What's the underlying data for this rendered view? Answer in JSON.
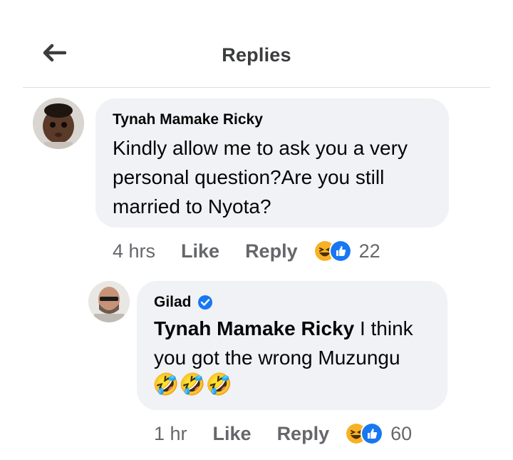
{
  "header": {
    "title": "Replies"
  },
  "comment": {
    "author": "Tynah Mamake Ricky",
    "text": "Kindly allow me to ask you a very personal question?Are you still married to Nyota?",
    "time": "4 hrs",
    "like_label": "Like",
    "reply_label": "Reply",
    "reaction_count": "22",
    "reactions": [
      "haha-icon",
      "like-icon"
    ]
  },
  "reply": {
    "author": "Gilad",
    "verified": true,
    "mention": "Tynah Mamake Ricky",
    "text": " I think you got the wrong Muzungu",
    "emoji": "🤣🤣🤣",
    "time": "1 hr",
    "like_label": "Like",
    "reply_label": "Reply",
    "reaction_count": "60",
    "reactions": [
      "haha-icon",
      "like-icon"
    ]
  },
  "colors": {
    "bubble": "#f0f2f5",
    "meta_text": "#65676b",
    "like_blue": "#1877f2",
    "haha_yellow": "#f7b125"
  }
}
